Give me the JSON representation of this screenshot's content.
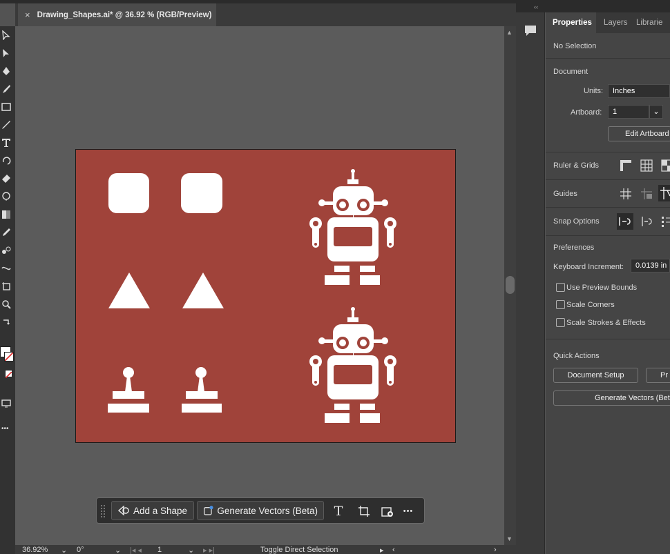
{
  "document_tab": {
    "close_glyph": "×",
    "title": "Drawing_Shapes.ai* @ 36.92 % (RGB/Preview)"
  },
  "artboard_color": "#a0433a",
  "shape_color": "#ffffff",
  "icons": {
    "toolbar": [
      "selection-tool-icon",
      "direct-selection-tool-icon",
      "pen-tool-icon",
      "brush-tool-icon",
      "rectangle-tool-icon",
      "pencil-tool-icon",
      "type-tool-icon",
      "rotate-tool-icon",
      "eraser-tool-icon",
      "shaper-tool-icon",
      "gradient-tool-icon",
      "eyedropper-tool-icon",
      "blend-tool-icon",
      "width-tool-icon",
      "artboard-tool-icon",
      "zoom-tool-icon",
      "swap-colors-icon",
      "fill-swatch-icon",
      "stroke-swatch-icon",
      "screen-mode-icon",
      "more-tools-icon"
    ]
  },
  "status_bar": {
    "zoom": "36.92%",
    "rotation": "0°",
    "artboard_number": "1",
    "tool_hint": "Toggle Direct Selection"
  },
  "taskbar": {
    "add_shape_label": "Add a Shape",
    "generate_vectors_label": "Generate Vectors (Beta)",
    "more_glyph": "•••"
  },
  "panel": {
    "collapse_glyph": "‹‹",
    "tabs": [
      "Properties",
      "Layers",
      "Librarie"
    ],
    "selection_state": "No Selection",
    "document_heading": "Document",
    "units_label": "Units:",
    "units_value": "Inches",
    "artboard_label": "Artboard:",
    "artboard_value": "1",
    "edit_artboards_label": "Edit Artboard",
    "ruler_grids_label": "Ruler & Grids",
    "guides_label": "Guides",
    "snap_options_label": "Snap Options",
    "preferences_heading": "Preferences",
    "keyboard_increment_label": "Keyboard Increment:",
    "keyboard_increment_value": "0.0139 in",
    "use_preview_bounds_label": "Use Preview Bounds",
    "scale_corners_label": "Scale Corners",
    "scale_strokes_label": "Scale Strokes & Effects",
    "quick_actions_heading": "Quick Actions",
    "document_setup_label": "Document Setup",
    "preferences_button_label": "Pr",
    "generate_vectors_label": "Generate Vectors (Bet"
  }
}
